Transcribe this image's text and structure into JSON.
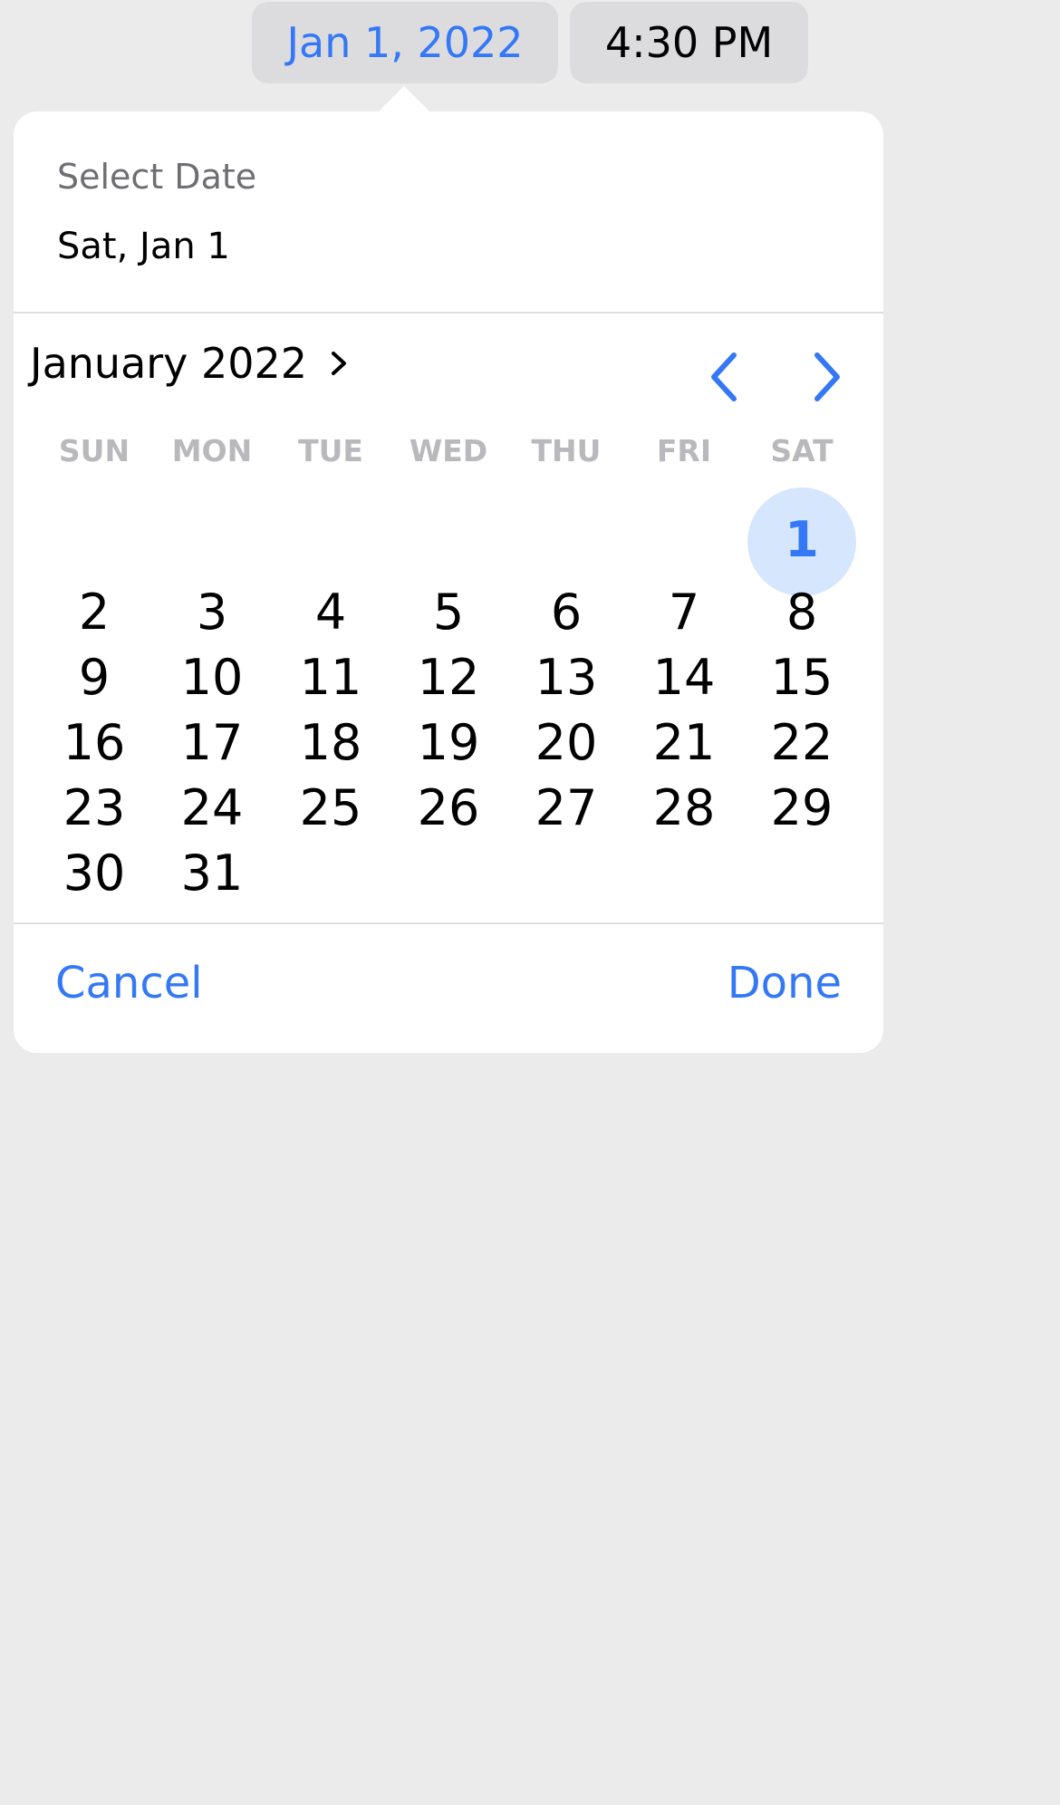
{
  "header_buttons": {
    "date": "Jan 1, 2022",
    "time": "4:30 PM"
  },
  "picker": {
    "label": "Select Date",
    "selected_display": "Sat, Jan 1",
    "month_title": "January 2022",
    "weekdays": [
      "SUN",
      "MON",
      "TUE",
      "WED",
      "THU",
      "FRI",
      "SAT"
    ],
    "weeks": [
      [
        "",
        "",
        "",
        "",
        "",
        "",
        "1"
      ],
      [
        "2",
        "3",
        "4",
        "5",
        "6",
        "7",
        "8"
      ],
      [
        "9",
        "10",
        "11",
        "12",
        "13",
        "14",
        "15"
      ],
      [
        "16",
        "17",
        "18",
        "19",
        "20",
        "21",
        "22"
      ],
      [
        "23",
        "24",
        "25",
        "26",
        "27",
        "28",
        "29"
      ],
      [
        "30",
        "31",
        "",
        "",
        "",
        "",
        ""
      ]
    ],
    "selected_day": "1",
    "cancel_label": "Cancel",
    "done_label": "Done"
  },
  "colors": {
    "accent": "#3478f6",
    "selected_fill": "#d5e6fd",
    "background": "#ebebec",
    "weekday_text": "#b9b9bd"
  },
  "icons": {
    "month_disclosure": "chevron-right-icon",
    "prev": "chevron-left-icon",
    "next": "chevron-right-icon"
  }
}
